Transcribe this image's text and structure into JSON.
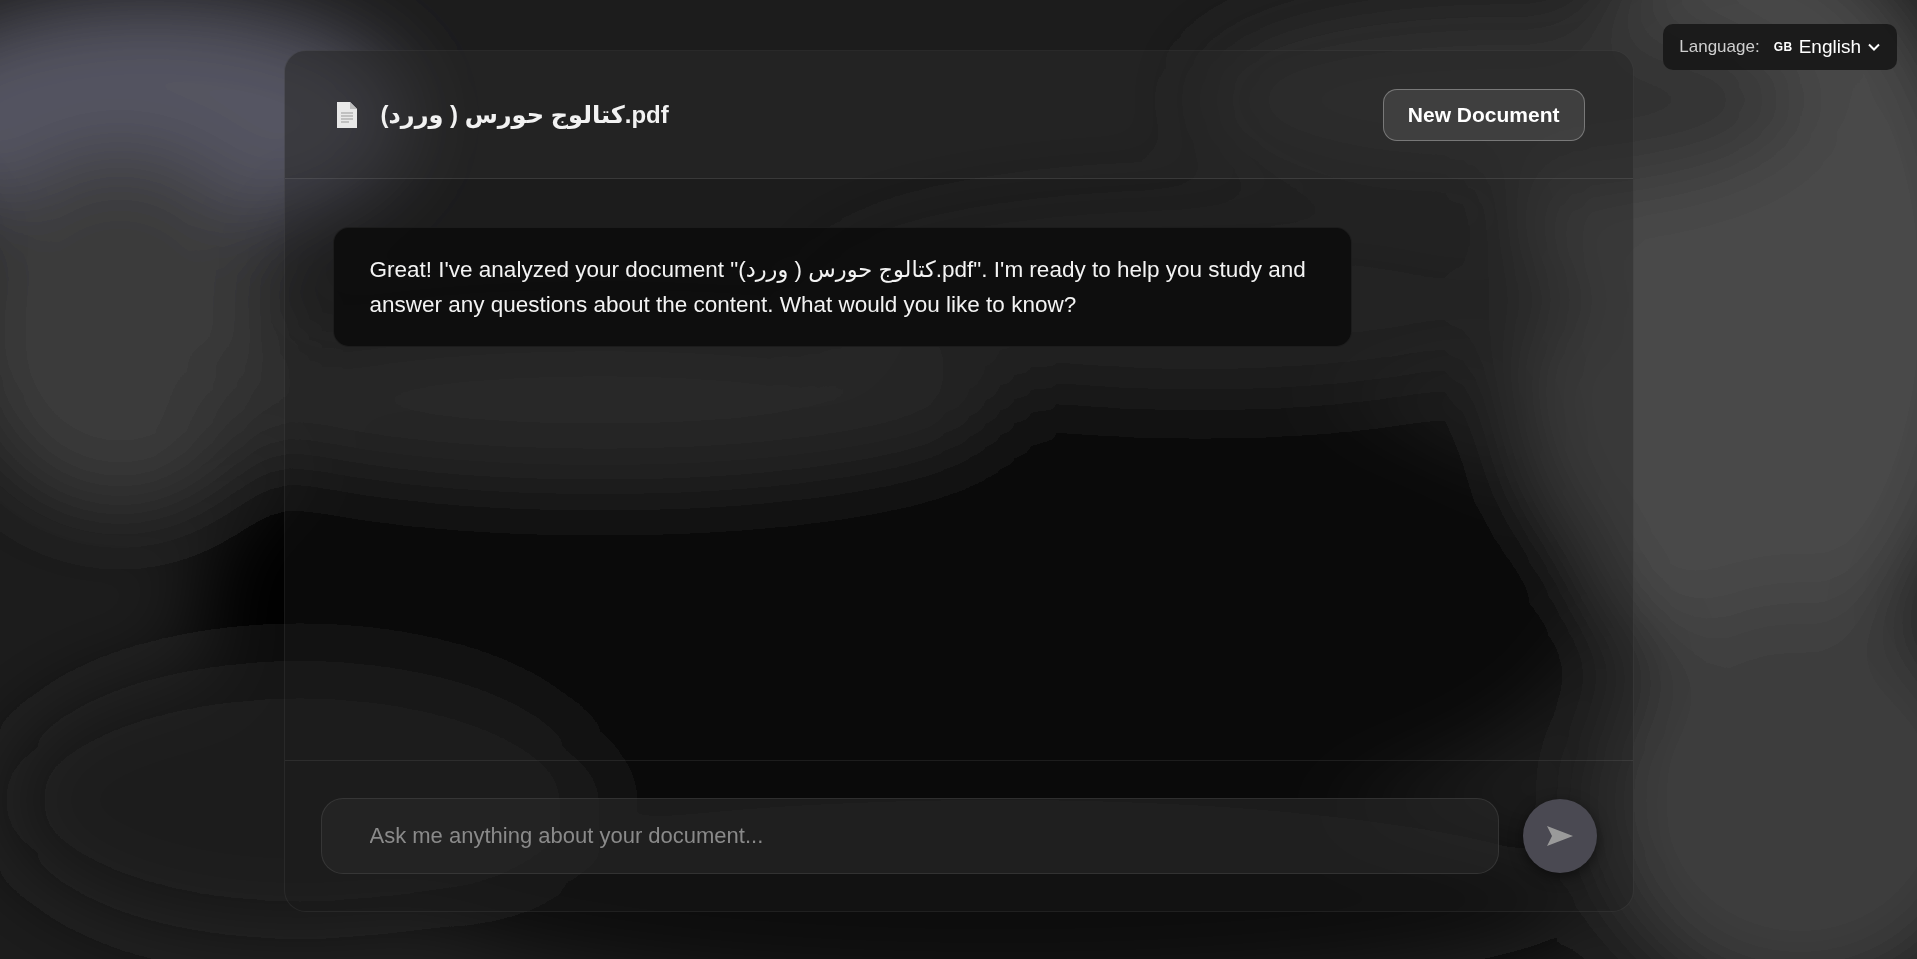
{
  "language": {
    "label": "Language:",
    "flag": "GB",
    "value": "English"
  },
  "header": {
    "filename": "كتالوج حورس ( وررد).pdf",
    "new_button": "New Document"
  },
  "messages": [
    {
      "kind": "assistant",
      "text": "Great! I've analyzed your document \"كتالوج حورس ( وررد).pdf\". I'm ready to help you study and answer any questions about the content. What would you like to know?"
    }
  ],
  "composer": {
    "placeholder": "Ask me anything about your document...",
    "send_disabled": true
  }
}
